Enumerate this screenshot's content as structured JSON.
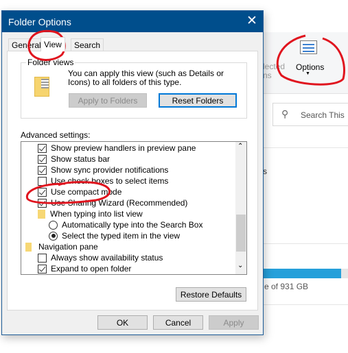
{
  "background": {
    "ribbon_partial_1": "lected",
    "ribbon_partial_2": "ns",
    "options_label": "Options",
    "search_placeholder": "Search This",
    "partial_s": "s",
    "storage_text": "e of 931 GB",
    "storage_fill_percent": 92
  },
  "dialog": {
    "title": "Folder Options",
    "tabs": [
      {
        "label": "General"
      },
      {
        "label": "View"
      },
      {
        "label": "Search"
      }
    ],
    "folder_views": {
      "legend": "Folder views",
      "description": "You can apply this view (such as Details or Icons) to all folders of this type.",
      "apply_label": "Apply to Folders",
      "reset_label": "Reset Folders"
    },
    "advanced_label": "Advanced settings:",
    "items": [
      {
        "type": "checkbox",
        "checked": true,
        "label": "Show preview handlers in preview pane"
      },
      {
        "type": "checkbox",
        "checked": true,
        "label": "Show status bar"
      },
      {
        "type": "checkbox",
        "checked": true,
        "label": "Show sync provider notifications"
      },
      {
        "type": "checkbox",
        "checked": false,
        "label": "Use check boxes to select items"
      },
      {
        "type": "checkbox",
        "checked": true,
        "label": "Use compact mode"
      },
      {
        "type": "checkbox",
        "checked": true,
        "label": "Use Sharing Wizard (Recommended)"
      },
      {
        "type": "folder",
        "label": "When typing into list view"
      },
      {
        "type": "radio",
        "checked": false,
        "label": "Automatically type into the Search Box"
      },
      {
        "type": "radio",
        "checked": true,
        "label": "Select the typed item in the view"
      },
      {
        "type": "group",
        "label": "Navigation pane"
      },
      {
        "type": "checkbox",
        "checked": false,
        "label": "Always show availability status"
      },
      {
        "type": "checkbox",
        "checked": true,
        "label": "Expand to open folder"
      }
    ],
    "restore_label": "Restore Defaults",
    "ok_label": "OK",
    "cancel_label": "Cancel",
    "apply_label": "Apply"
  },
  "colors": {
    "titlebar": "#004e8c",
    "annotation": "#e0141e",
    "progress": "#26a0da"
  }
}
